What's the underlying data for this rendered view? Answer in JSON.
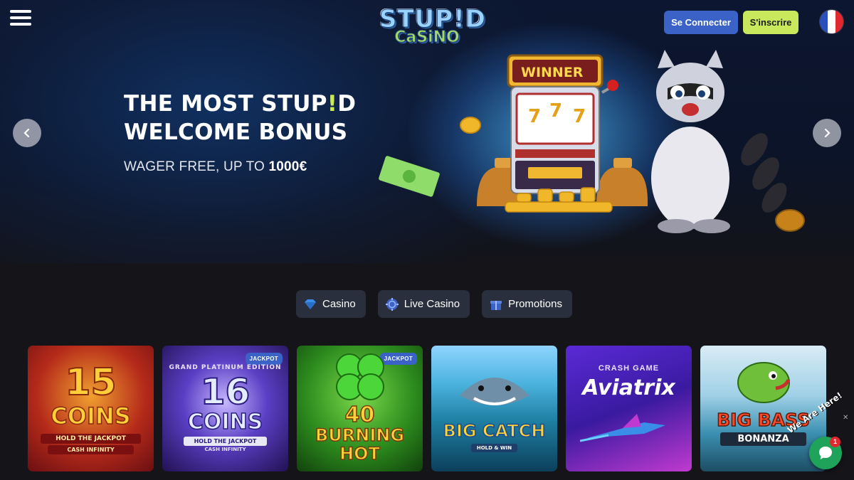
{
  "header": {
    "logo_top": "STUP!D",
    "logo_bottom": "CaSiNO",
    "login_label": "Se Connecter",
    "signup_label": "S'inscrire",
    "language": "FR"
  },
  "hero": {
    "title_line1_a": "THE MOST STUP",
    "title_line1_excl": "!",
    "title_line1_b": "D",
    "title_line2": "WELCOME BONUS",
    "subtitle_prefix": "WAGER FREE, UP TO ",
    "subtitle_amount": "1000€",
    "machine_sign": "WINNER"
  },
  "tabs": [
    {
      "label": "Casino",
      "icon": "diamond-icon"
    },
    {
      "label": "Live Casino",
      "icon": "chip-icon"
    },
    {
      "label": "Promotions",
      "icon": "gift-icon"
    }
  ],
  "games": [
    {
      "line1": "15",
      "line2": "COINS",
      "line3": "HOLD THE JACKPOT",
      "line4": "CASH INFINITY",
      "badge": ""
    },
    {
      "line1": "16",
      "line2": "COINS",
      "line3": "HOLD THE JACKPOT",
      "line4": "CASH INFINITY",
      "badge": "JACKPOT",
      "arc": "GRAND PLATINUM EDITION"
    },
    {
      "line1": "40",
      "line2": "BURNING",
      "line3": "HOT",
      "badge": "JACKPOT"
    },
    {
      "line1": "BIG CATCH",
      "line2": "HOLD & WIN",
      "badge": ""
    },
    {
      "line1": "CRASH GAME",
      "line2": "Aviatrix",
      "badge": ""
    },
    {
      "line1": "BIG BASS",
      "line2": "BONANZA",
      "badge": ""
    }
  ],
  "chat": {
    "label": "We Are Here!",
    "count": "1"
  },
  "colors": {
    "accent_blue": "#3b63c7",
    "accent_lime": "#c9e85c",
    "background": "#141419",
    "tab_bg": "#2a2f3d"
  }
}
